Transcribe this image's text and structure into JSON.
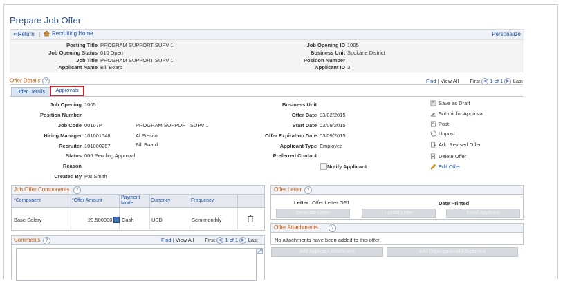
{
  "page": {
    "title": "Prepare Job Offer"
  },
  "nav": {
    "return_label": "Return",
    "separator": "|",
    "recruiting_home_label": "Recruiting Home",
    "personalize_label": "Personalize"
  },
  "header": {
    "posting_title_label": "Posting Title",
    "posting_title": "PROGRAM SUPPORT SUPV 1",
    "job_opening_status_label": "Job Opening Status",
    "job_opening_status": "010 Open",
    "job_title_label": "Job Title",
    "job_title": "PROGRAM SUPPORT SUPV 1",
    "applicant_name_label": "Applicant Name",
    "applicant_name": "Bill Board",
    "job_opening_id_label": "Job Opening ID",
    "job_opening_id": "1005",
    "business_unit_label": "Business Unit",
    "business_unit": "Spokane District",
    "position_number_label": "Position Number",
    "position_number": "",
    "applicant_id_label": "Applicant ID",
    "applicant_id": "3"
  },
  "offer_details": {
    "section_label": "Offer Details",
    "find_label": "Find",
    "view_all_label": "View All",
    "first_label": "First",
    "count_label": "1 of 1",
    "last_label": "Last",
    "tabs": [
      {
        "label": "Offer Details"
      },
      {
        "label": "Approvals"
      }
    ],
    "job_opening_label": "Job Opening",
    "job_opening": "1005",
    "position_number_label": "Position Number",
    "position_number": "",
    "job_code_label": "Job Code",
    "job_code": "00107P",
    "job_code_desc": "PROGRAM SUPPORT SUPV 1",
    "hiring_manager_label": "Hiring Manager",
    "hiring_manager": "101001548",
    "hiring_manager_name": "Al Fresco",
    "recruiter_label": "Recruiter",
    "recruiter": "101000267",
    "recruiter_name": "Bill Board",
    "status_label": "Status",
    "status": "006 Pending Approval",
    "reason_label": "Reason",
    "reason": "",
    "created_by_label": "Created By",
    "created_by": "Pat Smith",
    "business_unit_label": "Business Unit",
    "business_unit": "",
    "offer_date_label": "Offer Date",
    "offer_date": "03/02/2015",
    "start_date_label": "Start Date",
    "start_date": "03/09/2015",
    "offer_expiration_date_label": "Offer Expiration Date",
    "offer_expiration_date": "03/09/2015",
    "applicant_type_label": "Applicant Type",
    "applicant_type": "Employee",
    "preferred_contact_label": "Preferred Contact",
    "preferred_contact": "",
    "notify_applicant_label": "Notify Applicant",
    "actions": {
      "save_as_draft": "Save as Draft",
      "submit_for_approval": "Submit for Approval",
      "post": "Post",
      "unpost": "Unpost",
      "add_revised_offer": "Add Revised Offer",
      "delete_offer": "Delete Offer",
      "edit_offer": "Edit Offer"
    }
  },
  "components": {
    "section_label": "Job Offer Components",
    "columns": {
      "component": "*Component",
      "offer_amount": "*Offer Amount",
      "payment_mode": "Payment Mode",
      "currency": "Currency",
      "frequency": "Frequency"
    },
    "rows": [
      {
        "component": "Base Salary",
        "offer_amount": "20.500000",
        "payment_mode": "Cash",
        "currency": "USD",
        "frequency": "Semimonthly"
      }
    ]
  },
  "comments": {
    "section_label": "Comments",
    "find_label": "Find",
    "view_all_label": "View All",
    "first_label": "First",
    "count_label": "1 of 1",
    "last_label": "Last"
  },
  "offer_letter": {
    "section_label": "Offer Letter",
    "letter_label": "Letter",
    "letter_value": "Offer Letter OF1",
    "date_printed_label": "Date Printed",
    "generate_button": "Generate Letter",
    "upload_button": "Upload Letter",
    "email_button": "Email Applicant"
  },
  "offer_attachments": {
    "section_label": "Offer Attachments",
    "empty_text": "No attachments have been added to this offer.",
    "add_applicant_button": "Add Applicant Attachment",
    "add_org_button": "Add Organizational Attachment"
  },
  "colors": {
    "title": "#2c4f86",
    "link": "#1d53a8",
    "section": "#c65a11",
    "highlight": "#c0272d"
  }
}
